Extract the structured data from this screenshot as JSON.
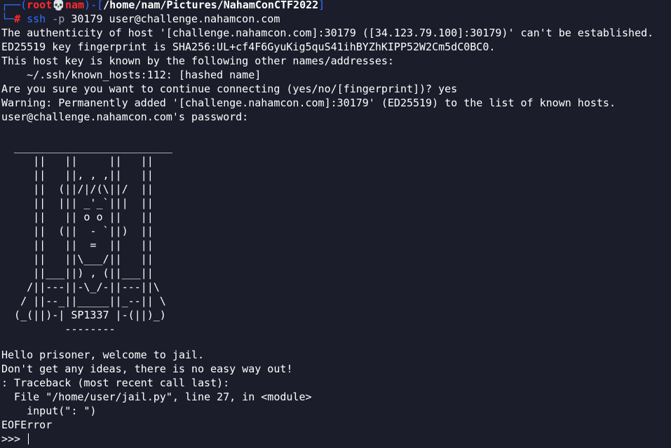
{
  "prompt": {
    "corner_top": "┌──",
    "open_paren": "(",
    "user": "root",
    "skull": "💀",
    "host": "nam",
    "close_paren": ")",
    "dash": "-",
    "open_bracket": "[",
    "path": "/home/nam/Pictures/NahamConCTF2022",
    "close_bracket": "]",
    "corner_bottom": "└─",
    "symbol": "#"
  },
  "command": {
    "program": "ssh",
    "flag": "-p",
    "args": "30179 user@challenge.nahamcon.com"
  },
  "output": {
    "auth_line": "The authenticity of host '[challenge.nahamcon.com]:30179 ([34.123.79.100]:30179)' can't be established.",
    "fingerprint_line": "ED25519 key fingerprint is SHA256:UL+cf4F6GyuKig5quS41ihBYZhKIPP52W2Cm5dC0BC0.",
    "known_line": "This host key is known by the following other names/addresses:",
    "known_hosts_line": "    ~/.ssh/known_hosts:112: [hashed name]",
    "confirm_line": "Are you sure you want to continue connecting (yes/no/[fingerprint])? yes",
    "warning_line": "Warning: Permanently added '[challenge.nahamcon.com]:30179' (ED25519) to the list of known hosts.",
    "password_line": "user@challenge.nahamcon.com's password:",
    "ascii_art": "  _________________________\n     ||   ||     ||   ||\n     ||   ||, , ,||   ||\n     ||  (||/|/(\\||/  ||\n     ||  ||| _'_`|||  ||\n     ||   || o o ||   ||\n     ||  (||  - `||)  ||\n     ||   ||  =  ||   ||\n     ||   ||\\___/||   ||\n     ||___||) , (||___||\n    /||---||-\\_/-||---||\\\n   / ||--_||_____||_--|| \\\n  (_(||)-| SP1337 |-(||)_)\n          --------",
    "hello_line": "Hello prisoner, welcome to jail.",
    "ideas_line": "Don't get any ideas, there is no easy way out!",
    "traceback_line": ": Traceback (most recent call last):",
    "file_line": "  File \"/home/user/jail.py\", line 27, in <module>",
    "input_line": "    input(\": \")",
    "error_line": "EOFError",
    "repl_prompt": ">>> "
  },
  "colors": {
    "background": "#1c1d2b",
    "prompt_frame": "#2c72ff",
    "prompt_user": "#ff2b2b",
    "text": "#ffffff"
  }
}
